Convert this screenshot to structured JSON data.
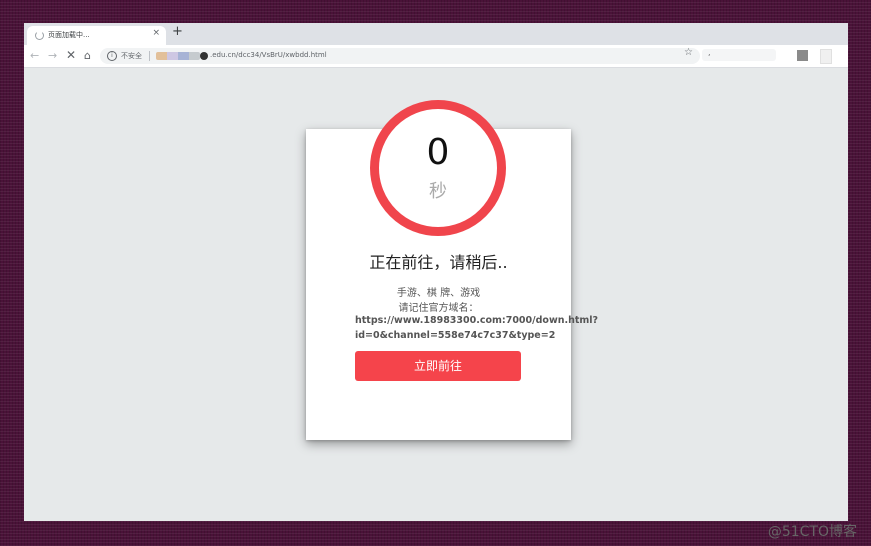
{
  "browser": {
    "tab_title": "页面加载中...",
    "tab_close": "×",
    "new_tab": "+",
    "security_label": "不安全",
    "url": ".edu.cn/dcc34/VsBrU/xwbdd.html",
    "profile_text": ","
  },
  "nav": {
    "back": "←",
    "forward": "→",
    "stop": "✕",
    "home": "⌂",
    "star": "☆",
    "info": "i"
  },
  "countdown": {
    "value": "0",
    "unit": "秒"
  },
  "redirect": {
    "heading": "正在前往，请稍后..",
    "line1": "手游、棋 牌、游戏",
    "line2": "请记住官方域名：",
    "link_line1": "https://www.18983300.com:7000/down.html?",
    "link_line2": "id=0&channel=558e74c7c37&type=2",
    "button_label": "立即前往"
  },
  "watermark": "@51CTO博客",
  "colors": {
    "accent": "#f5444b",
    "ring": "#f0454c",
    "page_bg": "#e6e9ea"
  }
}
